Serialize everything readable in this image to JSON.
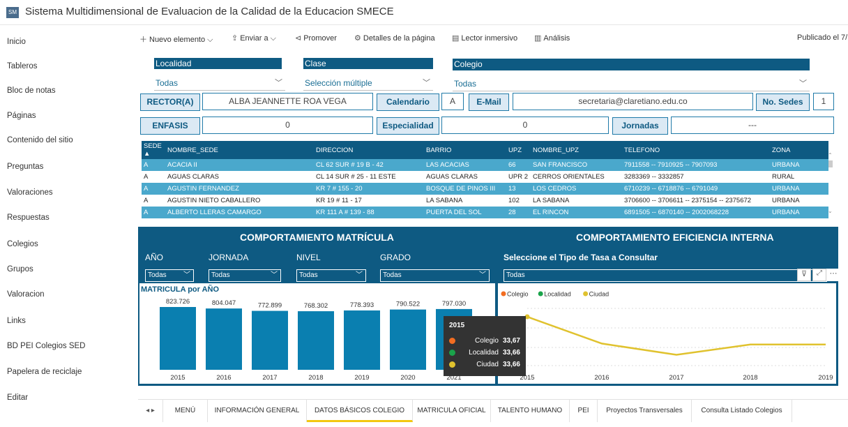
{
  "site": {
    "logo": "SM",
    "title": "Sistema Multidimensional de Evaluacion de la Calidad de la Educacion SMECE"
  },
  "sidebar": {
    "items": [
      "Inicio",
      "Tableros",
      "Bloc de notas",
      "Páginas",
      "Contenido del sitio",
      "Preguntas",
      "Valoraciones",
      "Respuestas",
      "Colegios",
      "Grupos",
      "Valoracion",
      "Links",
      "BD PEI Colegios SED",
      "Papelera de reciclaje",
      "Editar"
    ]
  },
  "commandbar": {
    "new": "Nuevo elemento",
    "send": "Enviar a",
    "promote": "Promover",
    "details": "Detalles de la página",
    "reader": "Lector inmersivo",
    "analytics": "Análisis",
    "published": "Publicado el 7/"
  },
  "filters": {
    "localidad_label": "Localidad",
    "localidad_value": "Todas",
    "clase_label": "Clase",
    "clase_value": "Selección múltiple",
    "colegio_label": "Colegio",
    "colegio_value": "Todas"
  },
  "info": {
    "rector_label": "RECTOR(A)",
    "rector_value": "ALBA JEANNETTE ROA VEGA",
    "calendario_label": "Calendario",
    "calendario_value": "A",
    "email_label": "E-Mail",
    "email_value": "secretaria@claretiano.edu.co",
    "sedes_label": "No. Sedes",
    "sedes_value": "1",
    "enfasis_label": "ENFASIS",
    "enfasis_value": "0",
    "especialidad_label": "Especialidad",
    "especialidad_value": "0",
    "jornadas_label": "Jornadas",
    "jornadas_value": "---"
  },
  "table": {
    "headers": [
      "SEDE",
      "NOMBRE_SEDE",
      "DIRECCION",
      "BARRIO",
      "UPZ",
      "NOMBRE_UPZ",
      "TELEFONO",
      "ZONA"
    ],
    "rows": [
      [
        "A",
        "ACACIA II",
        "CL 62 SUR # 19 B - 42",
        "LAS ACACIAS",
        "66",
        "SAN FRANCISCO",
        "7911558 -- 7910925 -- 7907093",
        "URBANA"
      ],
      [
        "A",
        "AGUAS CLARAS",
        "CL 14 SUR # 25 - 11 ESTE",
        "AGUAS CLARAS",
        "UPR 2",
        "CERROS ORIENTALES",
        "3283369 -- 3332857",
        "RURAL"
      ],
      [
        "A",
        "AGUSTIN FERNANDEZ",
        "KR 7 # 155 - 20",
        "BOSQUE DE PINOS III",
        "13",
        "LOS CEDROS",
        "6710239 -- 6718876 -- 6791049",
        "URBANA"
      ],
      [
        "A",
        "AGUSTIN NIETO CABALLERO",
        "KR 19 # 11 - 17",
        "LA SABANA",
        "102",
        "LA SABANA",
        "3706600 -- 3706611 -- 2375154 -- 2375672",
        "URBANA"
      ],
      [
        "A",
        "ALBERTO LLERAS CAMARGO",
        "KR 111 A # 139 - 88",
        "PUERTA DEL SOL",
        "28",
        "EL RINCON",
        "6891505 -- 6870140 -- 2002068228",
        "URBANA"
      ]
    ]
  },
  "matricula": {
    "title": "COMPORTAMIENTO MATRÍCULA",
    "slicers": [
      {
        "label": "AÑO",
        "value": "Todas"
      },
      {
        "label": "JORNADA",
        "value": "Todas"
      },
      {
        "label": "NIVEL",
        "value": "Todas"
      },
      {
        "label": "GRADO",
        "value": "Todas"
      }
    ]
  },
  "eficiencia": {
    "title": "COMPORTAMIENTO EFICIENCIA INTERNA",
    "select_label": "Seleccione el Tipo de Tasa a Consultar",
    "select_value": "Todas"
  },
  "chart_data": [
    {
      "type": "bar",
      "title": "MATRICULA por AÑO",
      "categories": [
        "2015",
        "2016",
        "2017",
        "2018",
        "2019",
        "2020",
        "2021"
      ],
      "values": [
        823726,
        804047,
        772899,
        768302,
        778393,
        790522,
        797030
      ],
      "value_labels": [
        "823.726",
        "804.047",
        "772.899",
        "768.302",
        "778.393",
        "790.522",
        "797.030"
      ],
      "ylim": [
        0,
        900000
      ],
      "color": "#0a7fb0"
    },
    {
      "type": "line",
      "x": [
        "2015",
        "2016",
        "2017",
        "2018",
        "2019"
      ],
      "legend": [
        "Colegio",
        "Localidad",
        "Ciudad"
      ],
      "legend_colors": [
        "#f26d21",
        "#1aa34a",
        "#e0c22e"
      ],
      "series": [
        {
          "name": "Ciudad",
          "values": [
            33.66,
            30.8,
            29.6,
            30.7,
            30.7
          ]
        }
      ],
      "ylim": [
        28,
        35
      ],
      "tooltip": {
        "year": "2015",
        "items": [
          {
            "name": "Colegio",
            "value": "33,67",
            "color": "#f26d21"
          },
          {
            "name": "Localidad",
            "value": "33,66",
            "color": "#1aa34a"
          },
          {
            "name": "Ciudad",
            "value": "33,66",
            "color": "#e0c22e"
          }
        ]
      }
    }
  ],
  "tabs": {
    "items": [
      "MENÚ",
      "INFORMACIÓN GENERAL",
      "DATOS BÁSICOS COLEGIO",
      "MATRICULA OFICIAL",
      "TALENTO HUMANO",
      "PEI",
      "Proyectos Transversales",
      "Consulta Listado Colegios"
    ],
    "active": 2
  }
}
